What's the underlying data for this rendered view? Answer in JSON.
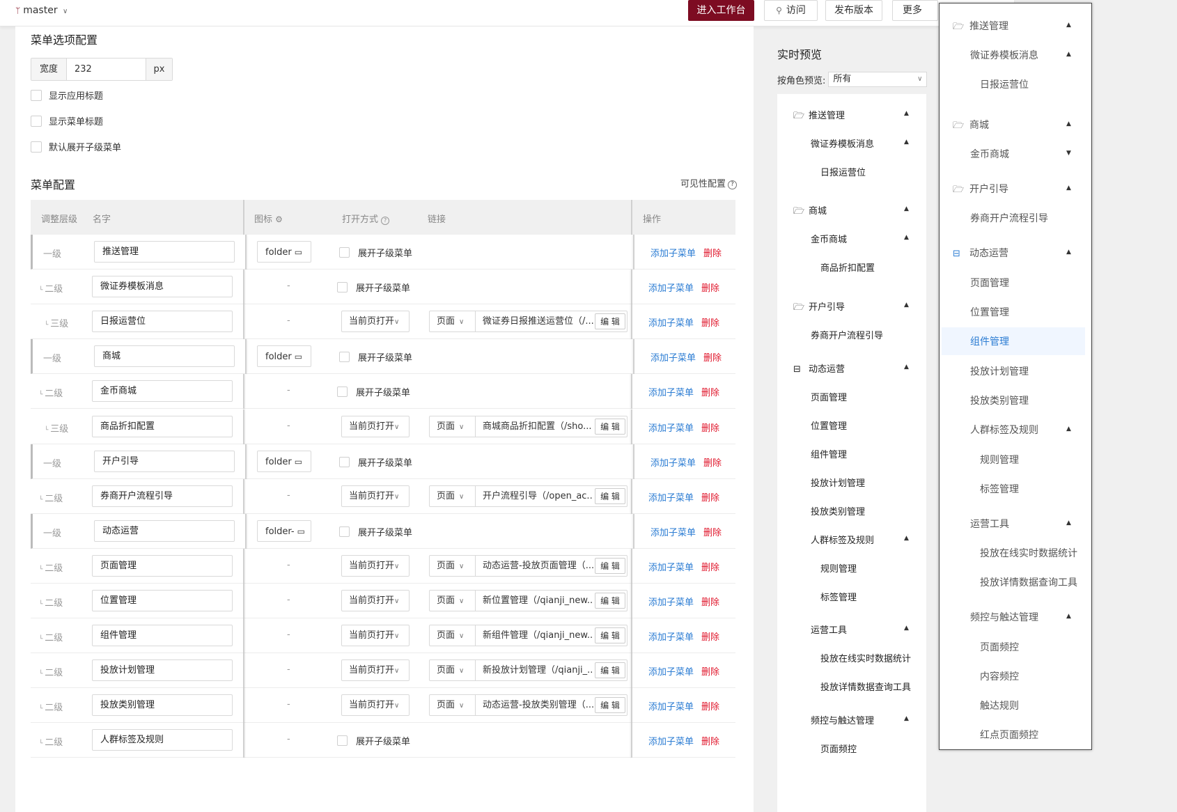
{
  "topbar": {
    "branch": "master",
    "enter_workbench": "进入工作台",
    "visit": "访问",
    "publish": "发布版本",
    "more": "更多"
  },
  "menu_options": {
    "title": "菜单选项配置",
    "width_label": "宽度",
    "width_value": "232",
    "width_unit": "px",
    "show_app_title": "显示应用标题",
    "show_menu_title": "显示菜单标题",
    "expand_default": "默认展开子级菜单"
  },
  "menu_config": {
    "title": "菜单配置",
    "visibility": "可见性配置",
    "headers": {
      "level": "调整层级",
      "name": "名字",
      "icon": "图标",
      "open": "打开方式",
      "link": "链接",
      "ops": "操作"
    },
    "add_label": "添加子菜单",
    "del_label": "删除",
    "expand_label": "展开子级菜单",
    "edit_label": "编 辑",
    "rows": [
      {
        "level": "一级",
        "name": "推送管理",
        "icon": "folder",
        "type": "group"
      },
      {
        "level": "二级",
        "name": "微证券模板消息",
        "type": "group"
      },
      {
        "level": "三级",
        "name": "日报运营位",
        "type": "page",
        "open": "当前页打开",
        "link_type": "页面",
        "link": "微证券日报推送运营位（/..."
      },
      {
        "level": "一级",
        "name": "商城",
        "icon": "folder",
        "type": "group"
      },
      {
        "level": "二级",
        "name": "金币商城",
        "type": "group"
      },
      {
        "level": "三级",
        "name": "商品折扣配置",
        "type": "page",
        "open": "当前页打开",
        "link_type": "页面",
        "link": "商城商品折扣配置（/sho..."
      },
      {
        "level": "一级",
        "name": "开户引导",
        "icon": "folder",
        "type": "group"
      },
      {
        "level": "二级",
        "name": "券商开户流程引导",
        "type": "page",
        "open": "当前页打开",
        "link_type": "页面",
        "link": "开户流程引导（/open_ac..."
      },
      {
        "level": "一级",
        "name": "动态运营",
        "icon": "folder-",
        "type": "group"
      },
      {
        "level": "二级",
        "name": "页面管理",
        "type": "page",
        "open": "当前页打开",
        "link_type": "页面",
        "link": "动态运营-投放页面管理（..."
      },
      {
        "level": "二级",
        "name": "位置管理",
        "type": "page",
        "open": "当前页打开",
        "link_type": "页面",
        "link": "新位置管理（/qianji_new..."
      },
      {
        "level": "二级",
        "name": "组件管理",
        "type": "page",
        "open": "当前页打开",
        "link_type": "页面",
        "link": "新组件管理（/qianji_new..."
      },
      {
        "level": "二级",
        "name": "投放计划管理",
        "type": "page",
        "open": "当前页打开",
        "link_type": "页面",
        "link": "新投放计划管理（/qianji_..."
      },
      {
        "level": "二级",
        "name": "投放类别管理",
        "type": "page",
        "open": "当前页打开",
        "link_type": "页面",
        "link": "动态运营-投放类别管理（..."
      },
      {
        "level": "二级",
        "name": "人群标签及规则",
        "type": "group"
      }
    ]
  },
  "preview": {
    "title": "实时预览",
    "role_label": "按角色预览:",
    "role_value": "所有",
    "items": [
      {
        "label": "推送管理",
        "icon": "folder-open-icon",
        "chev": "up"
      },
      {
        "label": "微证券模板消息",
        "chev": "up"
      },
      {
        "label": "日报运营位"
      },
      {
        "label": "商城",
        "icon": "folder-open-icon",
        "chev": "up"
      },
      {
        "label": "金币商城",
        "chev": "up"
      },
      {
        "label": "商品折扣配置"
      },
      {
        "label": "开户引导",
        "icon": "folder-open-icon",
        "chev": "up"
      },
      {
        "label": "券商开户流程引导"
      },
      {
        "label": "动态运营",
        "icon": "folder-dash-icon",
        "chev": "up"
      },
      {
        "label": "页面管理"
      },
      {
        "label": "位置管理"
      },
      {
        "label": "组件管理"
      },
      {
        "label": "投放计划管理"
      },
      {
        "label": "投放类别管理"
      },
      {
        "label": "人群标签及规则",
        "chev": "up"
      },
      {
        "label": "规则管理"
      },
      {
        "label": "标签管理"
      },
      {
        "label": "运营工具",
        "chev": "up"
      },
      {
        "label": "投放在线实时数据统计"
      },
      {
        "label": "投放详情数据查询工具"
      },
      {
        "label": "频控与触达管理",
        "chev": "up"
      },
      {
        "label": "页面频控"
      }
    ]
  },
  "side_panel": {
    "items": [
      {
        "label": "推送管理",
        "icon": "folder-open-icon",
        "chev": "up"
      },
      {
        "label": "微证券模板消息",
        "chev": "up"
      },
      {
        "label": "日报运营位"
      },
      {
        "label": "商城",
        "icon": "folder-open-icon",
        "chev": "up"
      },
      {
        "label": "金币商城",
        "chev": "down"
      },
      {
        "label": "开户引导",
        "icon": "folder-open-icon",
        "chev": "up"
      },
      {
        "label": "券商开户流程引导"
      },
      {
        "label": "动态运营",
        "icon": "folder-dash-icon",
        "chev": "up",
        "accent": true
      },
      {
        "label": "页面管理"
      },
      {
        "label": "位置管理"
      },
      {
        "label": "组件管理",
        "active": true
      },
      {
        "label": "投放计划管理"
      },
      {
        "label": "投放类别管理"
      },
      {
        "label": "人群标签及规则",
        "chev": "up"
      },
      {
        "label": "规则管理"
      },
      {
        "label": "标签管理"
      },
      {
        "label": "运营工具",
        "chev": "up"
      },
      {
        "label": "投放在线实时数据统计"
      },
      {
        "label": "投放详情数据查询工具"
      },
      {
        "label": "频控与触达管理",
        "chev": "up"
      },
      {
        "label": "页面频控"
      },
      {
        "label": "内容频控"
      },
      {
        "label": "触达规则"
      },
      {
        "label": "红点页面频控"
      }
    ]
  },
  "colors": {
    "brand": "#7d0c22",
    "link": "#2b7cd3",
    "danger": "#e0182d"
  }
}
